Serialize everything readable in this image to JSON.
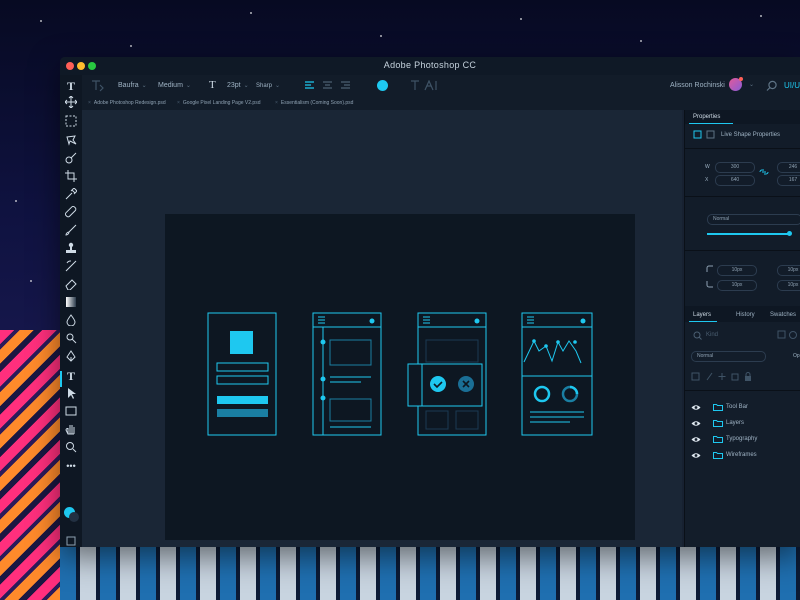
{
  "window": {
    "title": "Adobe Photoshop CC"
  },
  "options_bar": {
    "font_family": "Baufra",
    "font_weight": "Medium",
    "type_icon": "T",
    "font_size": "23pt",
    "antialias": "Sharp",
    "user_name": "Alisson Rochinski",
    "extra_label": "UI/U"
  },
  "document_tabs": [
    "Adobe Photoshop Redesign.psd",
    "Google Pixel Landing Page V2.psd",
    "Essentialism (Coming Soon).psd"
  ],
  "tools": [
    "T"
  ],
  "properties": {
    "tab": "Properties",
    "title": "Live Shape Properties",
    "w_label": "W",
    "w_value": "300",
    "h_value": "246",
    "x_label": "X",
    "x_value": "640",
    "y_value": "167",
    "blend_mode": "Normal",
    "corner_tl": "10px",
    "corner_tr": "10px",
    "corner_bl": "10px",
    "corner_br": "10px"
  },
  "layers_panel": {
    "tabs": [
      "Layers",
      "History",
      "Swatches"
    ],
    "search_placeholder": "Kind",
    "blend_mode": "Normal",
    "opacity_label": "Op",
    "items": [
      "Tool Bar",
      "Layers",
      "Typography",
      "Wireframes"
    ]
  },
  "colors": {
    "accent": "#1ec8f0",
    "window_bg": "#172131",
    "canvas_bg": "#0d1722"
  }
}
